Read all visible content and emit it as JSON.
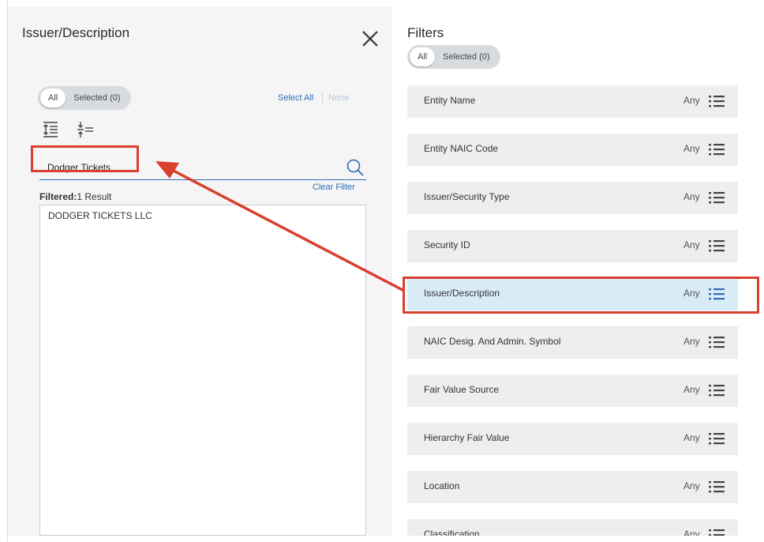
{
  "left_panel": {
    "title": "Issuer/Description",
    "toggle": {
      "all": "All",
      "selected": "Selected (0)"
    },
    "select_all": "Select All",
    "none": "None",
    "search": {
      "value": "Dodger Tickets"
    },
    "filtered_prefix": "Filtered:",
    "filtered_count": "1 Result",
    "clear_filter": "Clear Filter",
    "results": [
      "DODGER TICKETS LLC"
    ]
  },
  "right_panel": {
    "title": "Filters",
    "toggle": {
      "all": "All",
      "selected": "Selected (0)"
    },
    "filters": [
      {
        "label": "Entity Name",
        "value": "Any"
      },
      {
        "label": "Entity NAIC Code",
        "value": "Any"
      },
      {
        "label": "Issuer/Security Type",
        "value": "Any"
      },
      {
        "label": "Security ID",
        "value": "Any"
      },
      {
        "label": "Issuer/Description",
        "value": "Any"
      },
      {
        "label": "NAIC Desig. And Admin. Symbol",
        "value": "Any"
      },
      {
        "label": "Fair Value Source",
        "value": "Any"
      },
      {
        "label": "Hierarchy Fair Value",
        "value": "Any"
      },
      {
        "label": "Location",
        "value": "Any"
      },
      {
        "label": "Classification",
        "value": "Any"
      }
    ]
  },
  "colors": {
    "accent": "#2f6db5",
    "annotation": "#d9402e",
    "active_row": "#d9ebf7"
  }
}
